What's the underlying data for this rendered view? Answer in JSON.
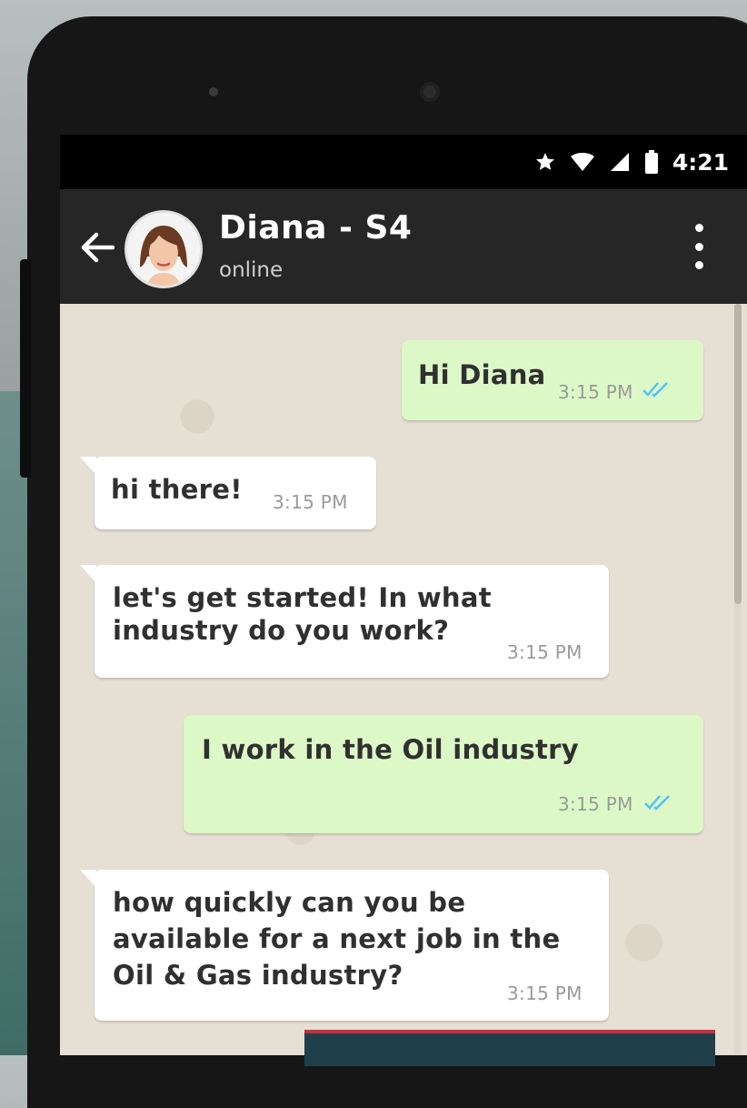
{
  "status_bar": {
    "time": "4:21",
    "icons": [
      "star-icon",
      "wifi-icon",
      "signal-icon",
      "battery-icon"
    ]
  },
  "chat_header": {
    "contact_name": "Diana - S4",
    "contact_status": "online"
  },
  "messages": [
    {
      "direction": "out",
      "text": "Hi Diana",
      "time": "3:15 PM",
      "status": "read"
    },
    {
      "direction": "in",
      "text": "hi there!",
      "time": "3:15 PM"
    },
    {
      "direction": "in",
      "text_lines": [
        "let's get started! In what",
        "industry do you work?"
      ],
      "time": "3:15 PM"
    },
    {
      "direction": "out",
      "text": "I work in the Oil industry",
      "time": "3:15 PM",
      "status": "read"
    },
    {
      "direction": "in",
      "text_lines": [
        "how quickly can you be",
        "available for a next job in the",
        "Oil & Gas industry?"
      ],
      "time": "3:15 PM"
    }
  ],
  "colors": {
    "outgoing_bubble": "#dcf8c6",
    "incoming_bubble": "#ffffff",
    "app_bar": "#262626",
    "read_ticks": "#4fc3f7"
  },
  "bottom_banner": {
    "text": ""
  }
}
